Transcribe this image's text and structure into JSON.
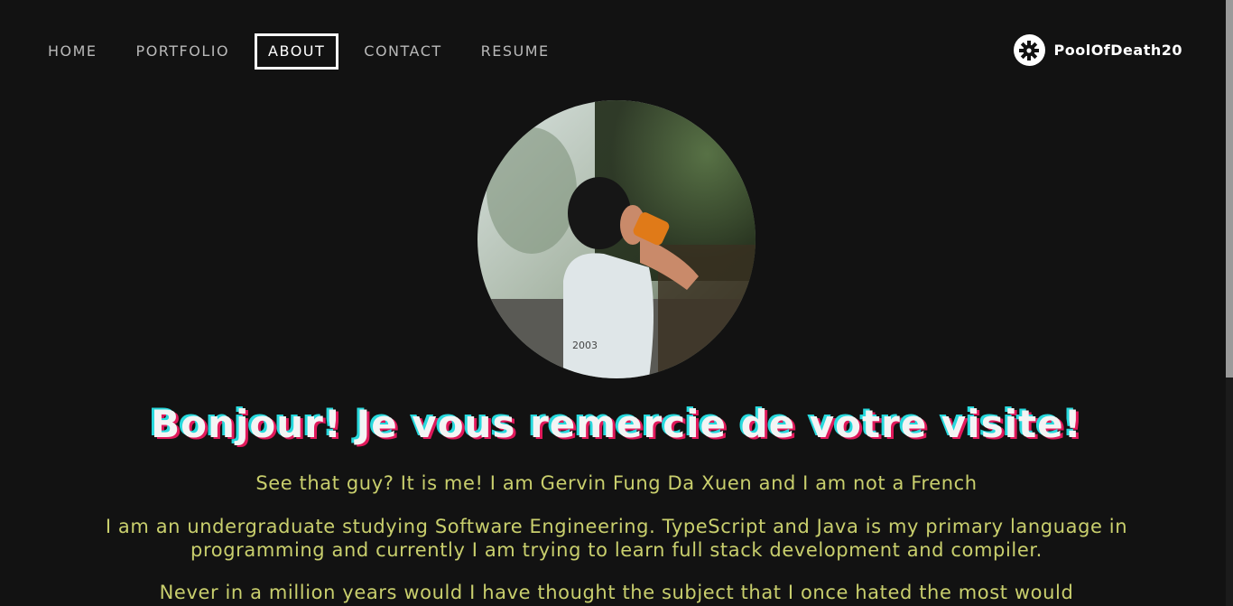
{
  "nav": {
    "items": [
      {
        "label": "HOME",
        "active": false
      },
      {
        "label": "PORTFOLIO",
        "active": false
      },
      {
        "label": "ABOUT",
        "active": true
      },
      {
        "label": "CONTACT",
        "active": false
      },
      {
        "label": "RESUME",
        "active": false
      }
    ]
  },
  "user": {
    "name": "PoolOfDeath20",
    "icon": "gear-icon"
  },
  "main": {
    "portrait_icon": "profile-photo",
    "heading": "Bonjour! Je vous remercie de votre visite!",
    "paragraphs": [
      "See that guy? It is me! I am Gervin Fung Da Xuen and I am not a French",
      "I am an undergraduate studying Software Engineering. TypeScript and Java is my primary language in programming and currently I am trying to learn full stack development and compiler.",
      "Never in a million years would I have thought the subject that I once hated the most would"
    ]
  },
  "colors": {
    "background": "#121212",
    "text_accent": "#c9cf6d",
    "glitch_cyan": "#27d9dd",
    "glitch_pink": "#e0195b"
  }
}
